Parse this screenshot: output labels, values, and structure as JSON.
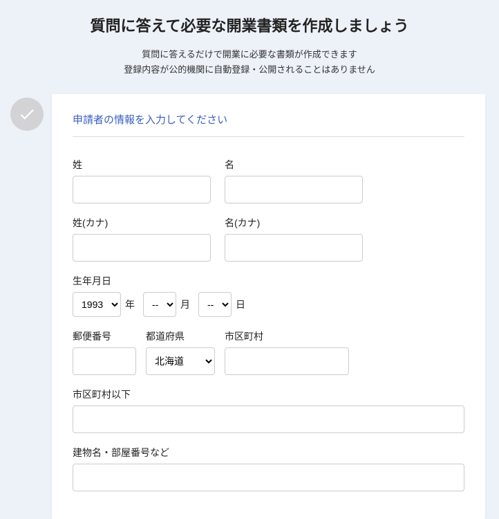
{
  "header": {
    "title": "質問に答えて必要な開業書類を作成しましょう",
    "subtitle_line1": "質問に答えるだけで開業に必要な書類が作成できます",
    "subtitle_line2": "登録内容が公的機関に自動登録・公開されることはありません"
  },
  "form": {
    "section_title": "申請者の情報を入力してください",
    "labels": {
      "last_name": "姓",
      "first_name": "名",
      "last_name_kana": "姓(カナ)",
      "first_name_kana": "名(カナ)",
      "birthdate": "生年月日",
      "year_suffix": "年",
      "month_suffix": "月",
      "day_suffix": "日",
      "postal": "郵便番号",
      "prefecture": "都道府県",
      "city": "市区町村",
      "address_detail": "市区町村以下",
      "building": "建物名・部屋番号など"
    },
    "values": {
      "last_name": "",
      "first_name": "",
      "last_name_kana": "",
      "first_name_kana": "",
      "year_selected": "1993",
      "month_selected": "--",
      "day_selected": "--",
      "postal": "",
      "prefecture_selected": "北海道",
      "city": "",
      "address_detail": "",
      "building": ""
    }
  }
}
